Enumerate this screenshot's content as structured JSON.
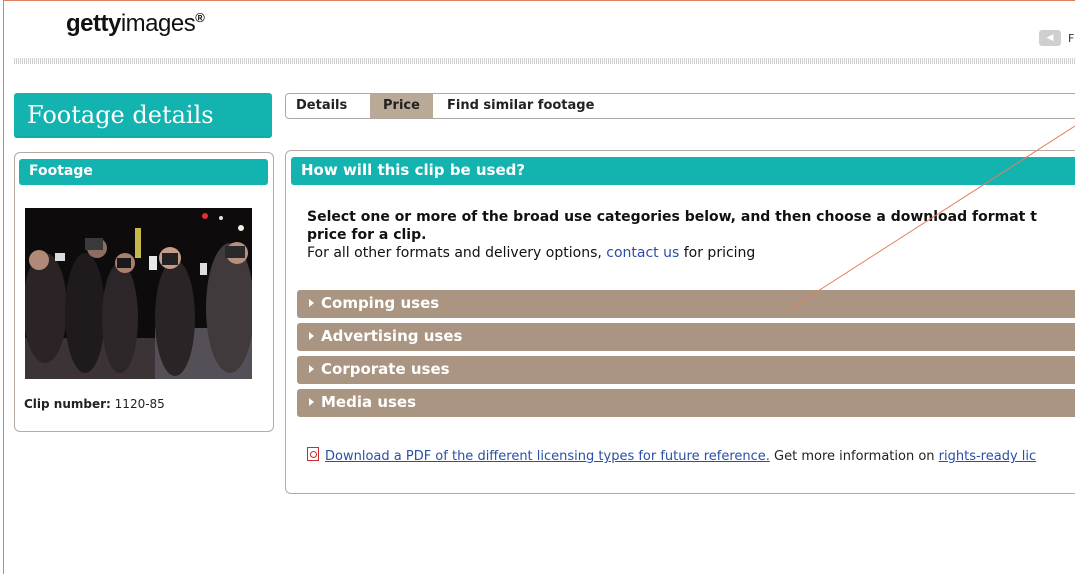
{
  "header": {
    "logo_bold": "getty",
    "logo_light": "images",
    "logo_reg": "®",
    "nav_letter": "F"
  },
  "page_title": "Footage details",
  "tabs": [
    {
      "label": "Details",
      "active": false
    },
    {
      "label": "Price",
      "active": true
    },
    {
      "label": "Find similar footage",
      "active": false
    }
  ],
  "footage_panel": {
    "header": "Footage",
    "clip_label": "Clip number:",
    "clip_value": "1120-85"
  },
  "usage": {
    "header": "How will this clip be used?",
    "instruction_bold": "Select one or more of the broad use categories below, and then choose a download format t",
    "instruction_bold_2": "price for a clip.",
    "other_prefix": "For all other formats and delivery options,",
    "contact_link": "contact us",
    "other_suffix": "for pricing",
    "categories": [
      {
        "label": "Comping uses"
      },
      {
        "label": "Advertising uses"
      },
      {
        "label": "Corporate uses"
      },
      {
        "label": "Media uses"
      }
    ],
    "pdf_link": "Download a PDF of the different licensing types for future reference.",
    "more_info": "Get more information on",
    "rights_link": "rights-ready lic"
  },
  "colors": {
    "teal": "#13b3b0",
    "category_bar": "#aa9482",
    "tab_active": "#b8aa96",
    "link": "#2a4fa8"
  }
}
